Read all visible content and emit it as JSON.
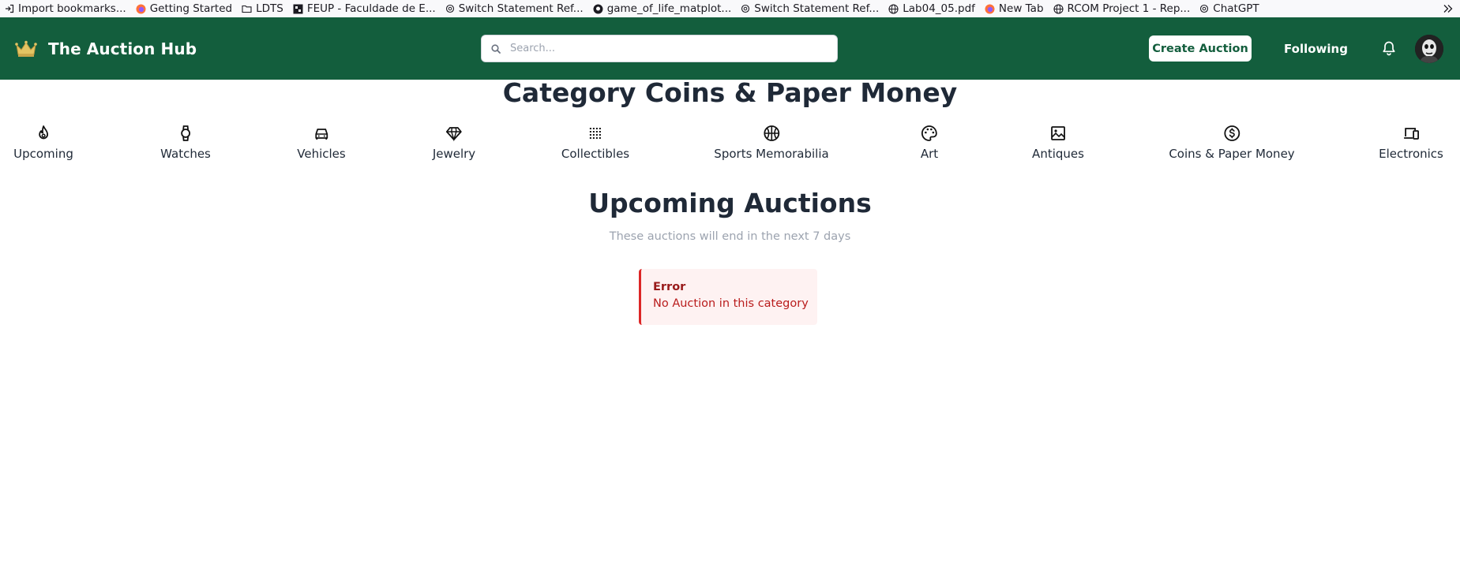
{
  "bookmarks": {
    "items": [
      {
        "label": "Import bookmarks...",
        "icon": "import-icon"
      },
      {
        "label": "Getting Started",
        "icon": "firefox-icon"
      },
      {
        "label": "LDTS",
        "icon": "folder-icon"
      },
      {
        "label": "FEUP - Faculdade de E...",
        "icon": "feup-icon"
      },
      {
        "label": "Switch Statement Ref...",
        "icon": "openai-icon"
      },
      {
        "label": "game_of_life_matplot...",
        "icon": "github-icon"
      },
      {
        "label": "Switch Statement Ref...",
        "icon": "openai-icon"
      },
      {
        "label": "Lab04_05.pdf",
        "icon": "globe-icon"
      },
      {
        "label": "New Tab",
        "icon": "firefox-icon"
      },
      {
        "label": "RCOM Project 1 - Rep...",
        "icon": "globe-icon"
      },
      {
        "label": "ChatGPT",
        "icon": "openai-icon"
      }
    ],
    "overflow_icon": "chevron-double-right-icon"
  },
  "header": {
    "brand_name": "The Auction Hub",
    "brand_icon": "crown-icon",
    "search_placeholder": "Search...",
    "create_auction_label": "Create Auction",
    "following_label": "Following",
    "notification_icon": "bell-icon",
    "brand_color": "#135e3d"
  },
  "main": {
    "category_title": "Category Coins & Paper Money",
    "categories": [
      {
        "label": "Upcoming",
        "icon": "fire-icon"
      },
      {
        "label": "Watches",
        "icon": "watch-icon"
      },
      {
        "label": "Vehicles",
        "icon": "car-icon"
      },
      {
        "label": "Jewelry",
        "icon": "diamond-icon"
      },
      {
        "label": "Collectibles",
        "icon": "grid-dots-icon"
      },
      {
        "label": "Sports Memorabilia",
        "icon": "basketball-icon"
      },
      {
        "label": "Art",
        "icon": "palette-icon"
      },
      {
        "label": "Antiques",
        "icon": "image-icon"
      },
      {
        "label": "Coins & Paper Money",
        "icon": "dollar-coin-icon"
      },
      {
        "label": "Electronics",
        "icon": "devices-icon"
      }
    ],
    "section_title": "Upcoming Auctions",
    "section_subtitle": "These auctions will end in the next 7 days",
    "alert": {
      "title": "Error",
      "message": "No Auction in this category",
      "color": "#dc2626"
    }
  }
}
